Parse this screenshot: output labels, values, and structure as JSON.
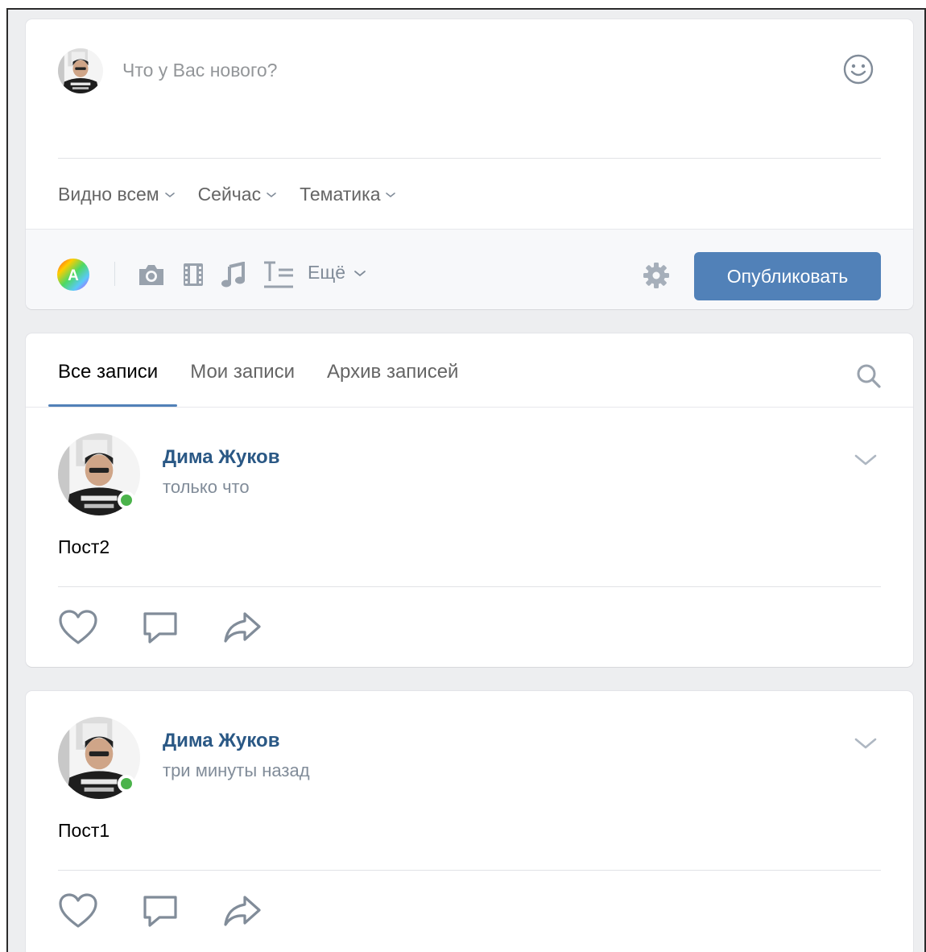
{
  "composer": {
    "placeholder": "Что у Вас нового?",
    "options": [
      {
        "label": "Видно всем"
      },
      {
        "label": "Сейчас"
      },
      {
        "label": "Тематика"
      }
    ],
    "more_label": "Ещё",
    "publish_label": "Опубликовать",
    "icons": [
      "color-palette-icon",
      "camera-icon",
      "video-icon",
      "music-icon",
      "text-format-icon",
      "gear-icon",
      "smile-icon"
    ]
  },
  "tabs": {
    "items": [
      {
        "label": "Все записи",
        "active": true
      },
      {
        "label": "Мои записи",
        "active": false
      },
      {
        "label": "Архив записей",
        "active": false
      }
    ]
  },
  "posts": [
    {
      "author": "Дима Жуков",
      "time": "только что",
      "text": "Пост2"
    },
    {
      "author": "Дима Жуков",
      "time": "три минуты назад",
      "text": "Пост1"
    }
  ],
  "colors": {
    "accent": "#5181b8",
    "link": "#2a5885",
    "online": "#4bb34b",
    "background": "#edeef0"
  }
}
